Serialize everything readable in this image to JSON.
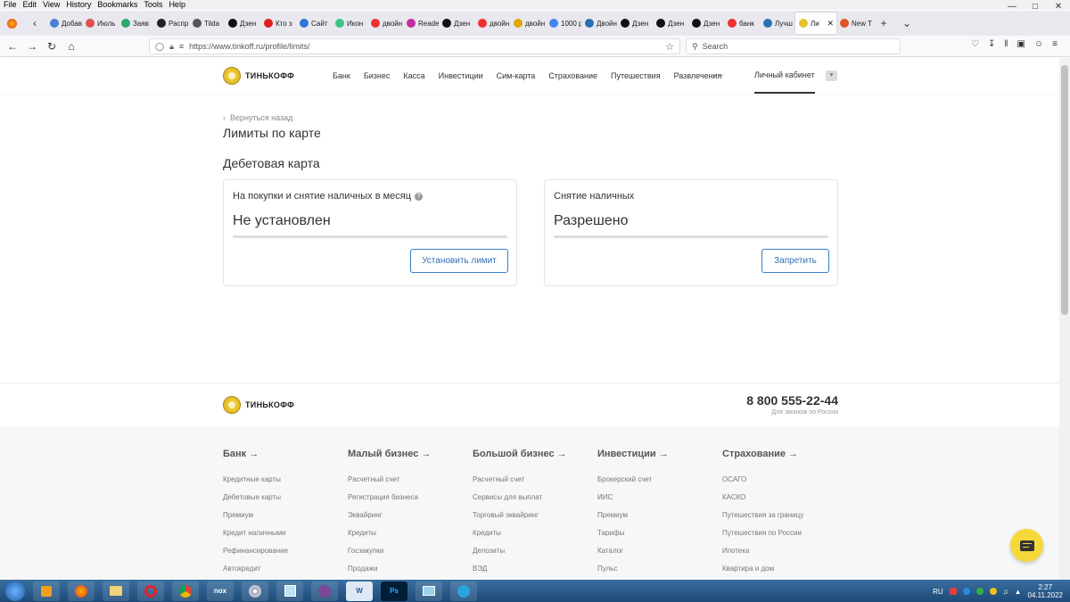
{
  "menubar": [
    "File",
    "Edit",
    "View",
    "History",
    "Bookmarks",
    "Tools",
    "Help"
  ],
  "tabs": [
    {
      "label": "Добав",
      "color": "#4a7fd4"
    },
    {
      "label": "Июль",
      "color": "#e05050"
    },
    {
      "label": "Заяв",
      "color": "#2aa86d"
    },
    {
      "label": "Распр",
      "color": "#222222"
    },
    {
      "label": "Tilda",
      "color": "#555555"
    },
    {
      "label": "Дзен",
      "color": "#111111"
    },
    {
      "label": "Кто з",
      "color": "#e01f1f"
    },
    {
      "label": "Сайт",
      "color": "#2f73d9"
    },
    {
      "label": "Икон",
      "color": "#3cc28a"
    },
    {
      "label": "двойн",
      "color": "#f03030"
    },
    {
      "label": "Reade",
      "color": "#c02ea0"
    },
    {
      "label": "Дзен",
      "color": "#111111"
    },
    {
      "label": "двойн",
      "color": "#f03030"
    },
    {
      "label": "двойн",
      "color": "#e0a800"
    },
    {
      "label": "1000 р",
      "color": "#4285f4"
    },
    {
      "label": "Двойн",
      "color": "#2b6fb0"
    },
    {
      "label": "Дзен",
      "color": "#111111"
    },
    {
      "label": "Дзен",
      "color": "#111111"
    },
    {
      "label": "Дзен",
      "color": "#111111"
    },
    {
      "label": "банк",
      "color": "#f03030"
    },
    {
      "label": "Лучш",
      "color": "#2b6fb0"
    }
  ],
  "active_tab": {
    "label": "Ли",
    "color": "#e6c12a"
  },
  "last_tab": {
    "label": "New T",
    "color": "#e0552b"
  },
  "url": "https://www.tinkoff.ru/profile/limits/",
  "search_placeholder": "Search",
  "logo_text": "ТИНЬКОФФ",
  "nav": [
    "Банк",
    "Бизнес",
    "Касса",
    "Инвестиции",
    "Сим-карта",
    "Страхование",
    "Путешествия",
    "Развлечения"
  ],
  "nav_more": "···",
  "cabinet": "Личный кабинет",
  "back_link": "Вернуться назад",
  "page_title": "Лимиты по карте",
  "section_title": "Дебетовая карта",
  "card1": {
    "label": "На покупки и снятие наличных в месяц",
    "help": "?",
    "value": "Не установлен",
    "button": "Установить лимит"
  },
  "card2": {
    "label": "Снятие наличных",
    "value": "Разрешено",
    "button": "Запретить"
  },
  "phone": "8 800 555-22-44",
  "phone_sub": "Для звонков по России",
  "footer_cols": [
    {
      "title": "Банк →",
      "items": [
        "Кредитные карты",
        "Дебетовые карты",
        "Премиум",
        "Кредит наличными",
        "Рефинансирование",
        "Автокредит"
      ]
    },
    {
      "title": "Малый бизнес →",
      "items": [
        "Расчетный счет",
        "Регистрация бизнеса",
        "Эквайринг",
        "Кредиты",
        "Госзакупки",
        "Продажи"
      ]
    },
    {
      "title": "Большой бизнес →",
      "items": [
        "Расчетный счет",
        "Сервисы для выплат",
        "Торговый эквайринг",
        "Кредиты",
        "Депозиты",
        "ВЭД"
      ]
    },
    {
      "title": "Инвестиции →",
      "items": [
        "Брокерский счет",
        "ИИС",
        "Премиум",
        "Тарифы",
        "Каталог",
        "Пульс"
      ]
    },
    {
      "title": "Страхование →",
      "items": [
        "ОСАГО",
        "КАСКО",
        "Путешествия за границу",
        "Путешествия по России",
        "Ипотека",
        "Квартира и дом"
      ]
    }
  ],
  "taskbar": {
    "lang": "RU",
    "time": "2:27",
    "date": "04.11.2022",
    "nox": "nox",
    "word": "W",
    "ps": "Ps"
  }
}
